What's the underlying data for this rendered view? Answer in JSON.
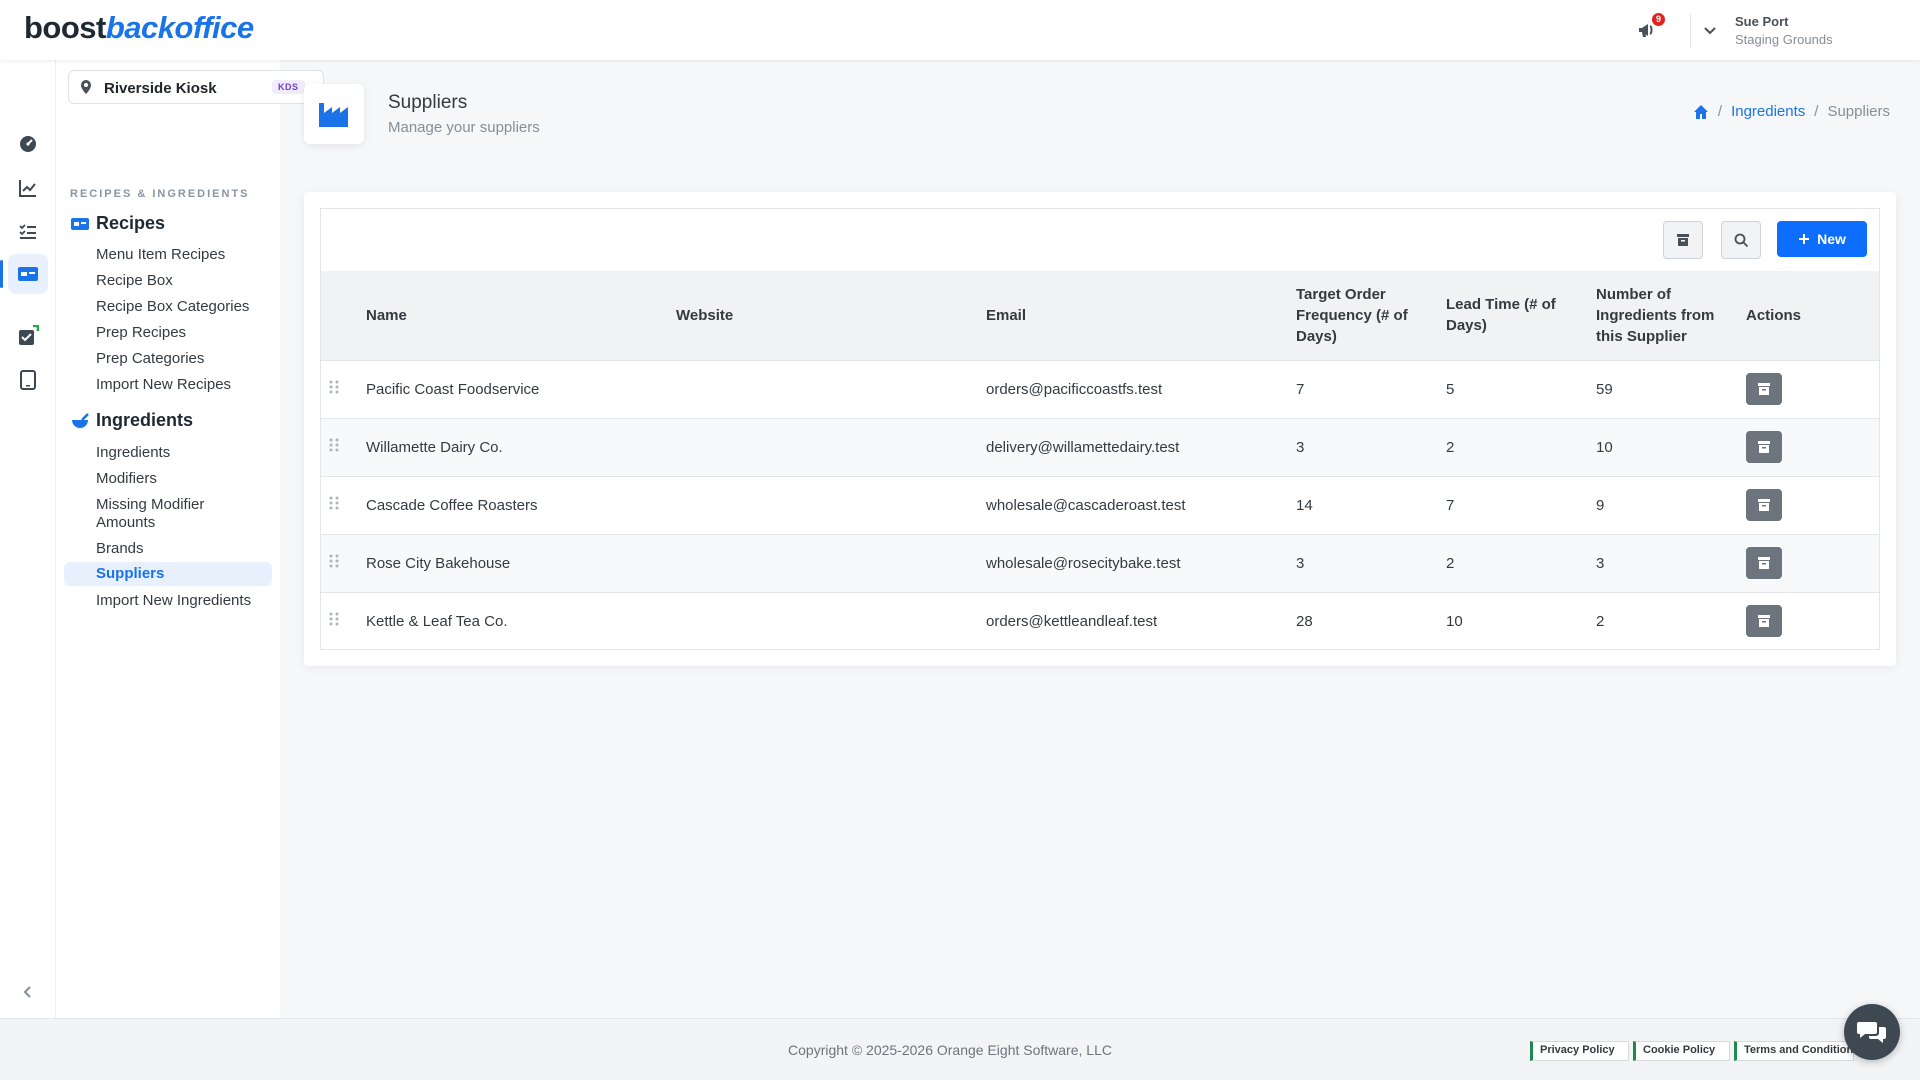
{
  "app": {
    "logo_part1": "boost",
    "logo_part2": "backoffice",
    "notification_count": "9",
    "user_name": "Sue Port",
    "user_org": "Staging Grounds"
  },
  "location": {
    "name": "Riverside Kiosk",
    "badge": "KDS"
  },
  "sidebar": {
    "section_title": "RECIPES & INGREDIENTS",
    "groups": [
      {
        "title": "Recipes",
        "items": [
          "Menu Item Recipes",
          "Recipe Box",
          "Recipe Box Categories",
          "Prep Recipes",
          "Prep Categories",
          "Import New Recipes"
        ]
      },
      {
        "title": "Ingredients",
        "items": [
          "Ingredients",
          "Modifiers",
          "Missing Modifier Amounts",
          "Brands",
          "Suppliers",
          "Import New Ingredients"
        ]
      }
    ],
    "active_item": "Suppliers"
  },
  "page": {
    "title": "Suppliers",
    "subtitle": "Manage your suppliers",
    "breadcrumb": [
      "Ingredients",
      "Suppliers"
    ]
  },
  "toolbar": {
    "new_label": "New"
  },
  "table": {
    "headers": {
      "name": "Name",
      "website": "Website",
      "email": "Email",
      "target_order_frequency": "Target Order Frequency (# of Days)",
      "lead_time": "Lead Time (# of Days)",
      "ingredients_count": "Number of Ingredients from this Supplier",
      "actions": "Actions"
    },
    "rows": [
      {
        "name": "Pacific Coast Foodservice",
        "website": "",
        "email": "orders@pacificcoastfs.test",
        "freq": "7",
        "lead": "5",
        "count": "59"
      },
      {
        "name": "Willamette Dairy Co.",
        "website": "",
        "email": "delivery@willamettedairy.test",
        "freq": "3",
        "lead": "2",
        "count": "10"
      },
      {
        "name": "Cascade Coffee Roasters",
        "website": "",
        "email": "wholesale@cascaderoast.test",
        "freq": "14",
        "lead": "7",
        "count": "9"
      },
      {
        "name": "Rose City Bakehouse",
        "website": "",
        "email": "wholesale@rosecitybake.test",
        "freq": "3",
        "lead": "2",
        "count": "3"
      },
      {
        "name": "Kettle & Leaf Tea Co.",
        "website": "",
        "email": "orders@kettleandleaf.test",
        "freq": "28",
        "lead": "10",
        "count": "2"
      }
    ]
  },
  "footer": {
    "copyright": "Copyright © 2025-2026 Orange Eight Software, LLC",
    "links": [
      "Privacy Policy",
      "Cookie Policy",
      "Terms and Conditions"
    ]
  },
  "colors": {
    "accent": "#1a73e8",
    "primary_button": "#0d6efd",
    "archive_button": "#6c757d"
  }
}
